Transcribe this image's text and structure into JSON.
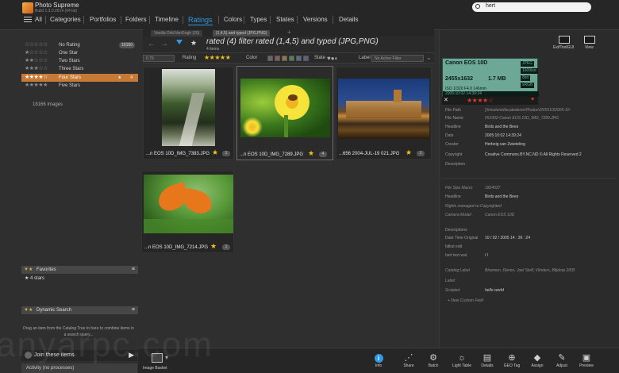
{
  "app": {
    "name": "Photo Supreme",
    "version": "Build 1.3.0.2614 (64 bit)"
  },
  "menu": [
    "All",
    "Categories",
    "Portfolios",
    "Folders",
    "Timeline",
    "Ratings",
    "Colors",
    "Types",
    "States",
    "Versions",
    "Details"
  ],
  "menu_active": "Ratings",
  "search": {
    "value": "hert"
  },
  "ratings": [
    {
      "stars": "☆☆☆☆☆",
      "label": "No Rating",
      "count": "16160"
    },
    {
      "stars": "★☆☆☆☆",
      "label": "One Star",
      "count": ""
    },
    {
      "stars": "★★☆☆☆",
      "label": "Two Stars",
      "count": ""
    },
    {
      "stars": "★★★☆☆",
      "label": "Three Stars",
      "count": ""
    },
    {
      "stars": "★★★★☆",
      "label": "Four Stars",
      "count": "4"
    },
    {
      "stars": "★★★★★",
      "label": "Five Stars",
      "count": ""
    }
  ],
  "image_count": "18166 Images",
  "favorites": {
    "title": "Favorites",
    "items": [
      "4 stars"
    ]
  },
  "dynamic_search": {
    "title": "Dynamic Search",
    "hint": "Drag an item from the Catalog Tree to here to combine items in a search query..."
  },
  "join": {
    "label": "Join these items"
  },
  "activity": {
    "label": "Activity (no processes)"
  },
  "tabs": [
    "Vanilla Dirk/VanGogh (20)",
    "(1,4,5) and typed (JPG,PNG)"
  ],
  "filter": {
    "title": "rated  (4) filter rated  (1,4,5) and typed (JPG,PNG)",
    "subtitle": "4 items",
    "text_filter_label": "Rating",
    "rating_stars": "★★★★★",
    "color_label": "Color",
    "state_label": "State",
    "label_label": "Label",
    "label_dropdown": "No Active Filter",
    "zoom_dropdown": "0.75"
  },
  "thumbnails": [
    {
      "caption": "...n EOS 10D_IMG_7383.JPG",
      "badge": "1"
    },
    {
      "caption": "...n EOS 10D_IMG_7289.JPG",
      "badge": "4"
    },
    {
      "caption": "...656 2004-JUL-19 021.JPG",
      "badge": "1"
    },
    {
      "caption": "...n EOS 10D_IMG_7214.JPG",
      "badge": "1"
    }
  ],
  "right_tools": [
    {
      "label": "ExifToolGUI",
      "icon": "exiftool-icon"
    },
    {
      "label": "View",
      "icon": "view-icon"
    }
  ],
  "lcd": {
    "camera": "Canon EOS 10D",
    "resolution": "2455x1632",
    "megapixels": "1.7 MB",
    "tags": [
      "JPEG",
      "1600iso",
      "8bit",
      "sRGB"
    ],
    "row2": "ISO   1/320   F4.0   146mm",
    "row3": "2005:10:02 14:39:24",
    "stars": "★★★★☆"
  },
  "metadata_top": [
    {
      "label": "File Path",
      "value": "[\\\\intuitentdlocatedemo\\Photos\\2005\\10\\2005-10-",
      "italic": true
    },
    {
      "label": "File Name",
      "value": "051002-Canon EOS 10D_IMG_7289.JPG",
      "italic": true
    },
    {
      "label": "Headline",
      "value": "Birds and the Bees",
      "italic": false
    },
    {
      "label": "Date",
      "value": "2005:10:02 14:39:24",
      "italic": false
    },
    {
      "label": "Creator",
      "value": "Herbeig van Zwieteling",
      "italic": false
    },
    {
      "label": "Copyright",
      "value": "Creative Commons.BY.NC.ND  © All Rights Reserved 2",
      "italic": false
    },
    {
      "label": "Description",
      "value": "",
      "italic": false
    }
  ],
  "metadata_bottom": [
    {
      "label": "File Size Macro",
      "value": "1824637",
      "style": "it"
    },
    {
      "label": "Headline",
      "value": "Birds and the Bees",
      "style": ""
    },
    {
      "label": "Rights managed re-Copyrighted",
      "value": "",
      "style": "it"
    },
    {
      "label": "Camera Model",
      "value": "Canon EOS 10D",
      "style": "it"
    },
    {
      "label": "Descriptions",
      "value": "",
      "style": ""
    },
    {
      "label": "Date Time Original",
      "value": "10 / 02 / 2005       14 : 39 : 24",
      "style": ""
    },
    {
      "label": "bitkst edit",
      "value": "",
      "style": ""
    },
    {
      "label": "hert text wat",
      "value": "  /      /",
      "style": ""
    },
    {
      "label": "Catalog Label",
      "value": "Bloemen, Dieren, Joel Stuff, Vlinders, Blijdorp 2005",
      "style": "it"
    },
    {
      "label": "Label",
      "value": "",
      "style": "it"
    },
    {
      "label": "Scripted",
      "value": "hello world",
      "style": "it2"
    },
    {
      "label": "+  New Custom Field",
      "value": "",
      "style": "it"
    }
  ],
  "image_basket": {
    "label": "Image Basket"
  },
  "bottom_actions": [
    {
      "label": "Info",
      "icon": "info-icon"
    },
    {
      "label": "Share",
      "icon": "share-icon"
    },
    {
      "label": "Batch",
      "icon": "batch-icon"
    },
    {
      "label": "Light Table",
      "icon": "light-table-icon"
    },
    {
      "label": "Details",
      "icon": "details-icon"
    },
    {
      "label": "GEO Tag",
      "icon": "geo-tag-icon"
    },
    {
      "label": "Assign",
      "icon": "assign-icon"
    },
    {
      "label": "Adjust",
      "icon": "adjust-icon"
    },
    {
      "label": "Preview",
      "icon": "preview-icon"
    }
  ],
  "watermark": "anyarpc.com",
  "colors": {
    "accent": "#2f9ae6",
    "selected_row": "#c77a35",
    "star": "#f0c020",
    "lcd": "#6da896"
  }
}
